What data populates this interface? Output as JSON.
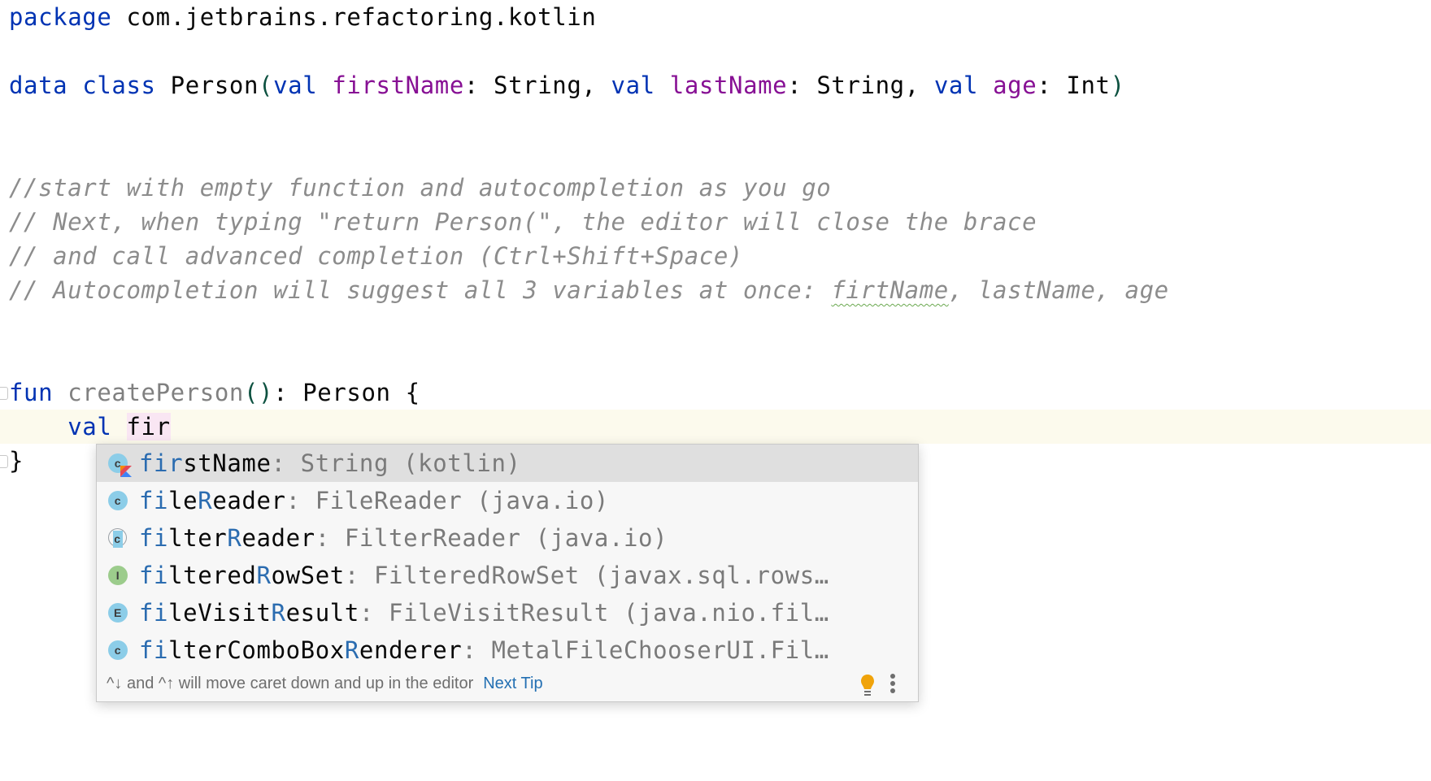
{
  "editor": {
    "lines": {
      "package": {
        "keyword": "package",
        "rest": " com.jetbrains.refactoring.kotlin"
      },
      "data_class": {
        "kw_data": "data",
        "kw_class": "class",
        "class_name": " Person",
        "open_paren": "(",
        "p1_kw": "val",
        "p1_name": "firstName",
        "p1_type": ": String, ",
        "p2_kw": "val",
        "p2_name": "lastName",
        "p2_type": ": String, ",
        "p3_kw": "val",
        "p3_name": "age",
        "p3_type": ": Int",
        "close_paren": ")"
      },
      "comments": [
        "//start with empty function and autocompletion as you go",
        "// Next, when typing \"return Person(\", the editor will close the brace",
        "// and call advanced completion (Ctrl+Shift+Space)"
      ],
      "comment4": {
        "before": "// Autocompletion will suggest all 3 variables at once: ",
        "typo": "firtName",
        "after": ", lastName, age"
      },
      "fun_line": {
        "keyword": "fun",
        "name": "createPerson",
        "parens": "()",
        "rest": ": Person {"
      },
      "val_line": {
        "indent": "    ",
        "keyword": "val",
        "typed": "fir"
      },
      "close_brace": "}"
    }
  },
  "completion_popup": {
    "items": [
      {
        "icon": "kotlin-property-icon",
        "icon_letter": "c",
        "kind": "class",
        "match": "fir",
        "rest_name": "stName",
        "tail": ": String (kotlin)",
        "selected": true
      },
      {
        "icon": "class-icon",
        "icon_letter": "c",
        "kind": "class",
        "parts": [
          "fi",
          "le",
          "R",
          "eader"
        ],
        "tail": ": FileReader (java.io)"
      },
      {
        "icon": "abstract-class-icon",
        "icon_letter": "c",
        "kind": "abstract",
        "parts": [
          "fi",
          "lter",
          "R",
          "eader"
        ],
        "tail": ": FilterReader (java.io)"
      },
      {
        "icon": "interface-icon",
        "icon_letter": "I",
        "kind": "iface",
        "parts": [
          "fi",
          "ltered",
          "R",
          "owSet"
        ],
        "tail": ": FilteredRowSet (javax.sql.rows…"
      },
      {
        "icon": "enum-icon",
        "icon_letter": "E",
        "kind": "enum",
        "parts": [
          "fi",
          "leVisit",
          "R",
          "esult"
        ],
        "tail": ": FileVisitResult (java.nio.fil…"
      },
      {
        "icon": "class-icon",
        "icon_letter": "c",
        "kind": "class",
        "parts": [
          "fi",
          "lterComboBox",
          "R",
          "enderer"
        ],
        "tail": ": MetalFileChooserUI.Fil…"
      }
    ],
    "footer": {
      "tip": "^↓ and ^↑ will move caret down and up in the editor",
      "next_tip": "Next Tip",
      "bulb_icon": "lightbulb-icon",
      "more_icon": "more-vertical-icon"
    }
  },
  "colors": {
    "keyword": "#0033b3",
    "property": "#871094",
    "comment": "#8c8c8c",
    "caret_line": "#fcfaed",
    "match_highlight": "#2b6cb0",
    "selected_row": "#dfdfdf",
    "bulb": "#f0a30a",
    "next_tip": "#2470b3"
  }
}
